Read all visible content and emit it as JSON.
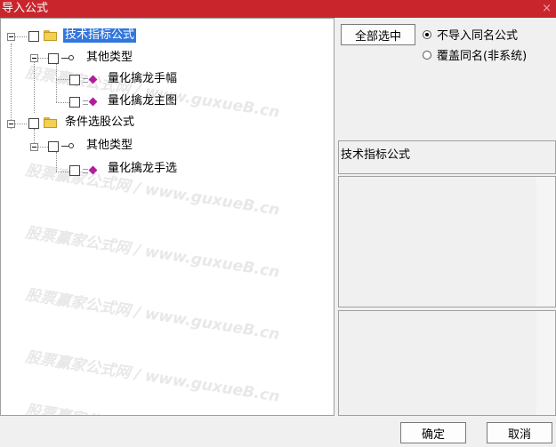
{
  "window": {
    "title": "导入公式",
    "close_glyph": "×"
  },
  "tree": [
    {
      "id": "n1",
      "label": "技术指标公式",
      "icon": "folder-icon",
      "selected": true
    },
    {
      "id": "n2",
      "label": "其他类型",
      "icon": "key-icon"
    },
    {
      "id": "n3",
      "label": "量化擒龙手幅",
      "icon": "formula-icon"
    },
    {
      "id": "n4",
      "label": "量化擒龙主图",
      "icon": "formula-icon"
    },
    {
      "id": "n5",
      "label": "条件选股公式",
      "icon": "folder-icon"
    },
    {
      "id": "n6",
      "label": "其他类型",
      "icon": "key-icon"
    },
    {
      "id": "n7",
      "label": "量化擒龙手选",
      "icon": "formula-icon"
    }
  ],
  "watermark": {
    "site": "股票赢家公式网",
    "sep": "/",
    "url": "www.guxueB.cn"
  },
  "controls": {
    "select_all_label": "全部选中",
    "radio_skip_label": "不导入同名公式",
    "radio_overwrite_label": "覆盖同名(非系统)",
    "selected_radio": "skip"
  },
  "info": {
    "selected_category": "技术指标公式"
  },
  "footer": {
    "ok_label": "确定",
    "cancel_label": "取消"
  }
}
